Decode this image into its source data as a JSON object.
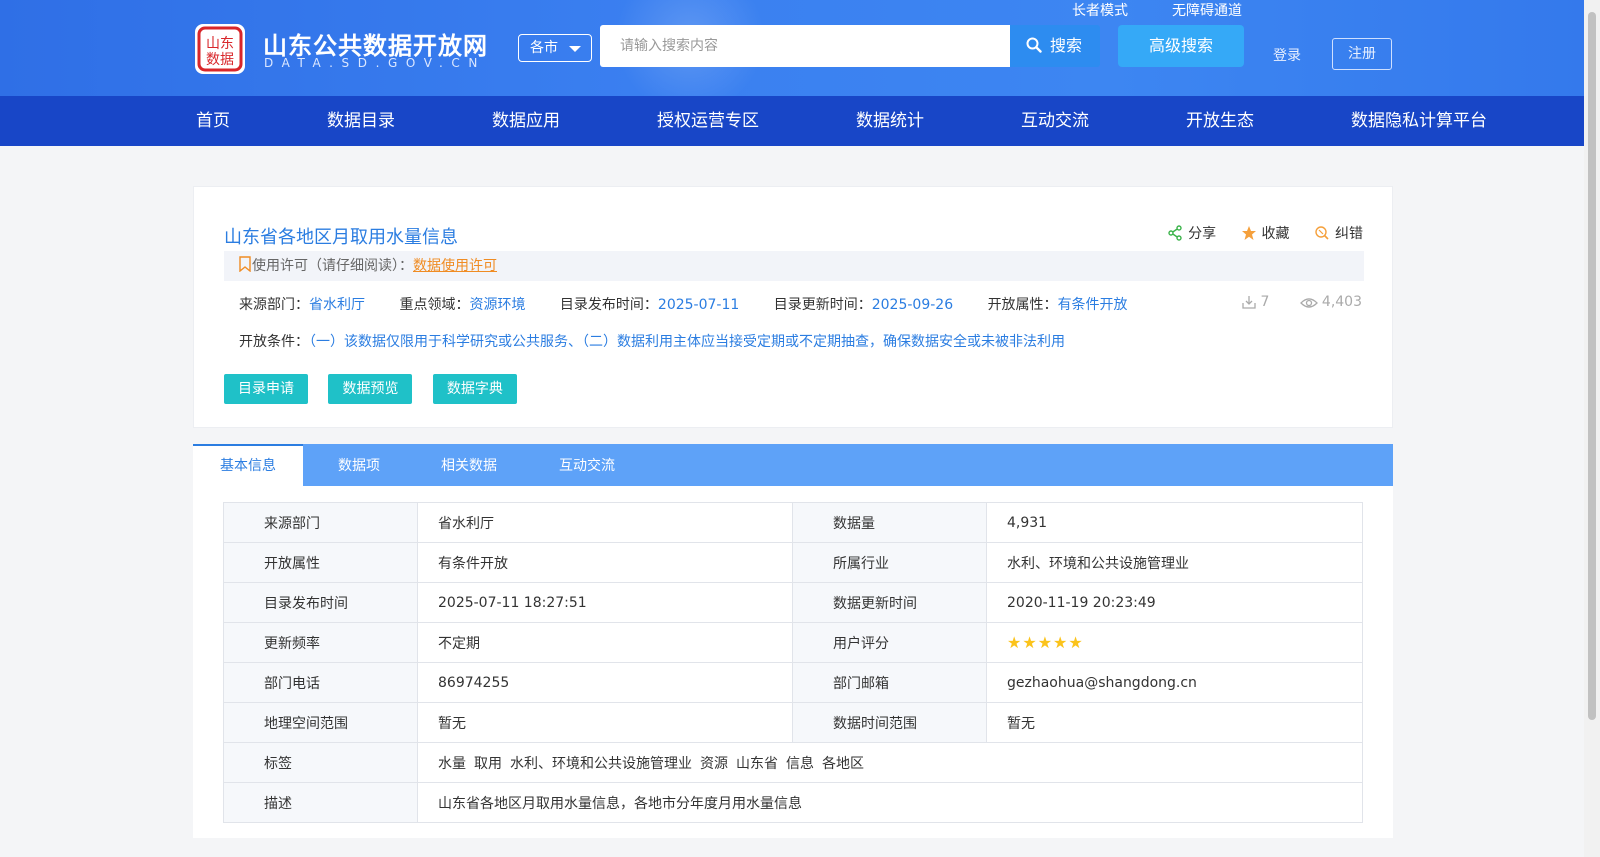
{
  "header": {
    "site_name": "山东公共数据开放网",
    "site_domain": "DATA.SD.GOV.CN",
    "city_select": "各市",
    "search_placeholder": "请输入搜索内容",
    "search_button": "搜索",
    "advanced_search": "高级搜索",
    "elder_mode": "长者模式",
    "accessibility": "无障碍通道",
    "login": "登录",
    "register": "注册",
    "brand_color": "#1846c7"
  },
  "nav": {
    "items": [
      "首页",
      "数据目录",
      "数据应用",
      "授权运营专区",
      "数据统计",
      "互动交流",
      "开放生态",
      "数据隐私计算平台"
    ]
  },
  "dataset": {
    "title": "山东省各地区月取用水量信息",
    "actions": {
      "share": "分享",
      "favorite": "收藏",
      "correct": "纠错"
    },
    "license_label": "使用许可（请仔细阅读）：",
    "license_link": "数据使用许可",
    "meta": {
      "source_label": "来源部门：",
      "source_value": "省水利厅",
      "domain_label": "重点领域：",
      "domain_value": "资源环境",
      "publish_label": "目录发布时间：",
      "publish_value": "2025-07-11",
      "update_label": "目录更新时间：",
      "update_value": "2025-09-26",
      "open_label": "开放属性：",
      "open_value": "有条件开放"
    },
    "downloads": "7",
    "views": "4,403",
    "conditions_label": "开放条件：",
    "conditions_value": "（一）该数据仅限用于科学研究或公共服务、（二）数据利用主体应当接受定期或不定期抽查，确保数据安全或未被非法利用",
    "buttons": {
      "apply": "目录申请",
      "preview": "数据预览",
      "dictionary": "数据字典"
    }
  },
  "tabs": [
    "基本信息",
    "数据项",
    "相关数据",
    "互动交流"
  ],
  "info_table": {
    "rows": [
      {
        "k1": "来源部门",
        "v1": "省水利厅",
        "k2": "数据量",
        "v2": "4,931"
      },
      {
        "k1": "开放属性",
        "v1": "有条件开放",
        "k2": "所属行业",
        "v2": "水利、环境和公共设施管理业"
      },
      {
        "k1": "目录发布时间",
        "v1": "2025-07-11 18:27:51",
        "k2": "数据更新时间",
        "v2": "2020-11-19 20:23:49"
      },
      {
        "k1": "更新频率",
        "v1": "不定期",
        "k2": "用户评分",
        "v2": ""
      },
      {
        "k1": "部门电话",
        "v1": "86974255",
        "k2": "部门邮箱",
        "v2": "gezhaohua@shangdong.cn"
      },
      {
        "k1": "地理空间范围",
        "v1": "暂无",
        "k2": "数据时间范围",
        "v2": "暂无"
      }
    ],
    "rating": 5,
    "tags_label": "标签",
    "tags": [
      "水量",
      "取用",
      "水利、环境和公共设施管理业",
      "资源",
      "山东省",
      "信息",
      "各地区"
    ],
    "desc_label": "描述",
    "desc_value": "山东省各地区月取用水量信息，各地市分年度月用水量信息"
  }
}
